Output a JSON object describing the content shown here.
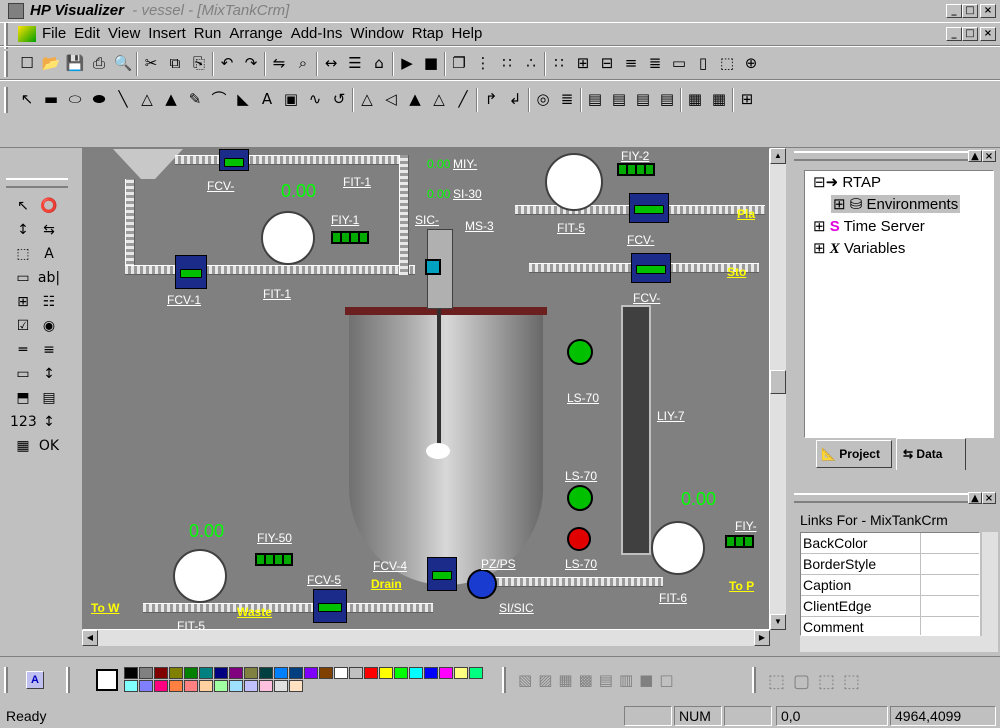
{
  "window": {
    "app": "HP Visualizer",
    "title": "- vessel - [MixTankCrm]",
    "btn_min": "_",
    "btn_max": "□",
    "btn_close": "×"
  },
  "menu": [
    "File",
    "Edit",
    "View",
    "Insert",
    "Run",
    "Arrange",
    "Add-Ins",
    "Window",
    "Rtap",
    "Help"
  ],
  "toolbar1": [
    "☐",
    "📂",
    "💾",
    "⎙",
    "🔍",
    "✂",
    "⧉",
    "⎘",
    "↶",
    "↷",
    "⇋",
    "⌕",
    "↔",
    "☰",
    "⌂",
    "▶",
    "■",
    "❐",
    "⋮",
    "∷",
    "∴",
    "∷",
    "⊞",
    "⊟",
    "≡",
    "≣",
    "▭",
    "▯",
    "⬚",
    "⊕"
  ],
  "toolbar2": [
    "↖",
    "▬",
    "⬭",
    "⬬",
    "╲",
    "△",
    "▲",
    "✎",
    "⌒",
    "◣",
    "A",
    "▣",
    "∿",
    "↺",
    "△",
    "◁",
    "▲",
    "△",
    "╱",
    "↱",
    "↲",
    "◎",
    "≣",
    "▤",
    "▤",
    "▤",
    "▤",
    "▦",
    "▦",
    "⊞"
  ],
  "palette": [
    "↖",
    "⭕",
    "↕",
    "⇆",
    "⬚",
    "A",
    "▭",
    "ab|",
    "⊞",
    "☷",
    "☑",
    "◉",
    "═",
    "≡",
    "▭",
    "↕",
    "⬒",
    "▤",
    "123",
    "↕",
    "▦",
    "OK"
  ],
  "process": {
    "num_top": "0.00",
    "num_fcv1": "0.00",
    "num_mid1": "0.00",
    "num_mid2": "0.00",
    "num_bl": "0.00",
    "num_br": "0.00",
    "labels": {
      "fcv_top": "FCV-",
      "fit_top": "FIT-1",
      "miy": "MIY-",
      "si30": "SI-30",
      "fiy2": "FIY-2",
      "fiy1": "FIY-1",
      "sic": "SIC-",
      "ms3": "MS-3",
      "fit5": "FIT-5",
      "fcv_r1": "FCV-",
      "fcv1": "FCV-1",
      "fit1": "FIT-1",
      "fcv_r2": "FCV-",
      "ls70a": "LS-70",
      "liy7": "LIY-7",
      "ls70b": "LS-70",
      "fiy50": "FIY-50",
      "fiy_r": "FIY-",
      "fcv4": "FCV-4",
      "fcv5": "FCV-5",
      "pz": "PZ/PS",
      "ls70c": "LS-70",
      "sisic": "SI/SIC",
      "fit_r": "FIT-6",
      "fit_bl": "FIT-5"
    },
    "ylabels": {
      "pla": "Pla",
      "sto": "Sto",
      "drain": "Drain",
      "tow": "To W",
      "waste": "Waste",
      "top": "To P"
    }
  },
  "tree": {
    "root": "RTAP",
    "env": "Environments",
    "time": "Time Server",
    "vars": "Variables"
  },
  "tabs": {
    "project": "Project",
    "data": "Data"
  },
  "links": {
    "title": "Links For - MixTankCrm",
    "props": [
      "BackColor",
      "BorderStyle",
      "Caption",
      "ClientEdge",
      "Comment"
    ]
  },
  "colors": [
    "#000000",
    "#808080",
    "#800000",
    "#808000",
    "#008000",
    "#008080",
    "#000080",
    "#800080",
    "#808040",
    "#004040",
    "#0080ff",
    "#004080",
    "#8000ff",
    "#804000",
    "#ffffff",
    "#c0c0c0",
    "#ff0000",
    "#ffff00",
    "#00ff00",
    "#00ffff",
    "#0000ff",
    "#ff00ff",
    "#ffff80",
    "#00ff80",
    "#80ffff",
    "#8080ff",
    "#ff0080",
    "#ff8040",
    "#ff8080",
    "#ffd0a0",
    "#a0ffa0",
    "#a0e0ff",
    "#c0c0ff",
    "#ffc0e0",
    "#e0e0e0",
    "#ffe0c0"
  ],
  "status": {
    "ready": "Ready",
    "num": "NUM",
    "coord": "0,0",
    "size": "4964,4099"
  }
}
